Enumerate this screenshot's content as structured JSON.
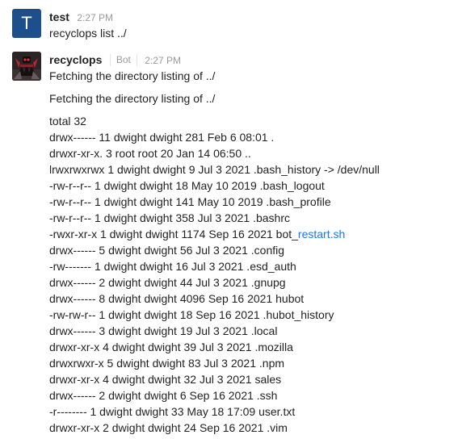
{
  "messages": [
    {
      "author": "test",
      "avatar_letter": "T",
      "time": "2:27 PM",
      "text": "recyclops list ../"
    },
    {
      "author": "recyclops",
      "badge": "Bot",
      "time": "2:27 PM",
      "line1": "Fetching the directory listing of ../",
      "line2": "Fetching the directory listing of ../",
      "listing_header": "total 32",
      "entries": [
        "drwx------ 11 dwight dwight 281 Feb 6 08:01 .",
        "drwxr-xr-x. 3 root root 20 Jan 14 06:50 ..",
        "lrwxrwxrwx 1 dwight dwight 9 Jul 3 2021 .bash_history -> /dev/null",
        "-rw-r--r-- 1 dwight dwight 18 May 10 2019 .bash_logout",
        "-rw-r--r-- 1 dwight dwight 141 May 10 2019 .bash_profile",
        "-rw-r--r-- 1 dwight dwight 358 Jul 3 2021 .bashrc",
        "-rwxr-xr-x 1 dwight dwight 1174 Sep 16 2021 bot_",
        "drwx------ 5 dwight dwight 56 Jul 3 2021 .config",
        "-rw------- 1 dwight dwight 16 Jul 3 2021 .esd_auth",
        "drwx------ 2 dwight dwight 44 Jul 3 2021 .gnupg",
        "drwx------ 8 dwight dwight 4096 Sep 16 2021 hubot",
        "-rw-rw-r-- 1 dwight dwight 18 Sep 16 2021 .hubot_history",
        "drwx------ 3 dwight dwight 19 Jul 3 2021 .local",
        "drwxr-xr-x 4 dwight dwight 39 Jul 3 2021 .mozilla",
        "drwxrwxr-x 5 dwight dwight 83 Jul 3 2021 .npm",
        "drwxr-xr-x 4 dwight dwight 32 Jul 3 2021 sales",
        "drwx------ 2 dwight dwight 6 Sep 16 2021 .ssh",
        "-r-------- 1 dwight dwight 33 May 18 17:09 user.txt",
        "drwxr-xr-x 2 dwight dwight 24 Sep 16 2021 .vim"
      ],
      "link_text": "restart.sh"
    }
  ]
}
